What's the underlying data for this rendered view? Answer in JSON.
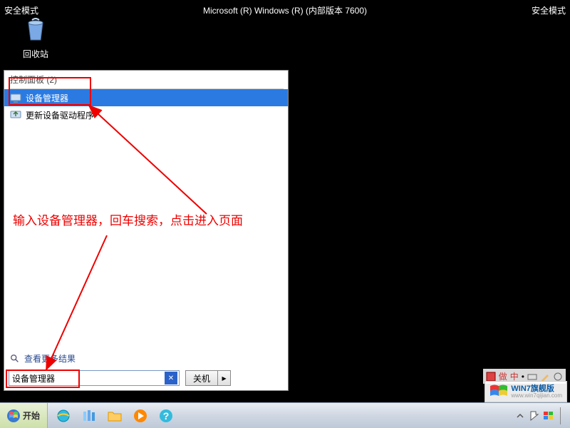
{
  "safemode": {
    "left": "安全模式",
    "right": "安全模式",
    "center": "Microsoft (R) Windows (R) (内部版本 7600)"
  },
  "desktop": {
    "recycle_bin": "回收站"
  },
  "start_menu": {
    "section_header": "控制面板 (2)",
    "results": [
      {
        "label": "设备管理器",
        "icon": "device-manager"
      },
      {
        "label": "更新设备驱动程序",
        "icon": "driver-update"
      }
    ],
    "see_more": "查看更多结果",
    "search_value": "设备管理器",
    "shutdown_label": "关机"
  },
  "annotation": {
    "text": "输入设备管理器，回车搜索，点击进入页面"
  },
  "taskbar": {
    "start_label": "开始",
    "pinned": [
      "internet-explorer",
      "library",
      "explorer",
      "media-player",
      "help"
    ]
  },
  "watermark": {
    "title": "WIN7旗舰版",
    "url": "www.win7qijian.com"
  }
}
